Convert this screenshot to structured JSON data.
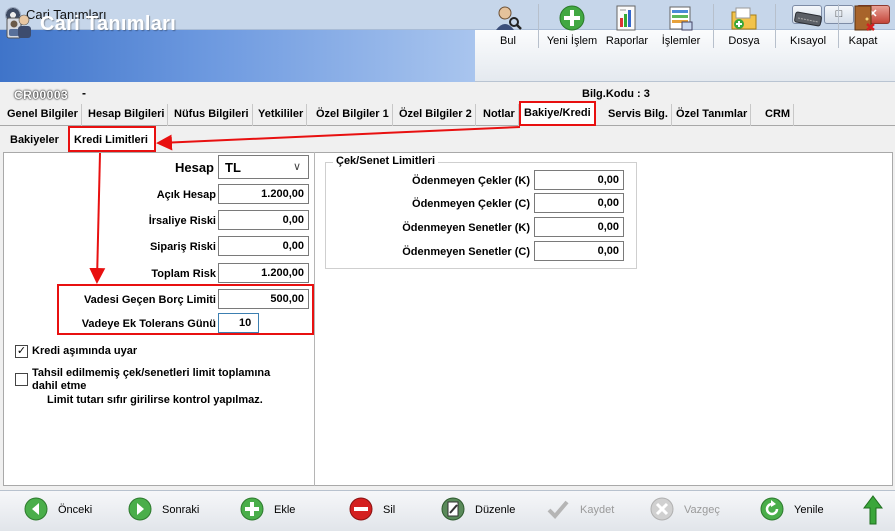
{
  "window": {
    "title": "Cari Tanımları"
  },
  "banner": {
    "title": "Cari Tanımları"
  },
  "toolbar": [
    {
      "label": "Bul",
      "icon": "user-search-icon"
    },
    {
      "label": "Yeni İşlem",
      "icon": "plus-circle-icon"
    },
    {
      "label": "Raporlar",
      "icon": "report-icon"
    },
    {
      "label": "İşlemler",
      "icon": "list-chart-icon"
    },
    {
      "label": "Dosya",
      "icon": "folder-icon"
    },
    {
      "label": "Kısayol",
      "icon": "keyboard-icon"
    },
    {
      "label": "Kapat",
      "icon": "door-exit-icon"
    }
  ],
  "record": {
    "code": "CR00003",
    "dash": "-",
    "bilg_kodu": "Bilg.Kodu : 3"
  },
  "tabs": [
    "Genel Bilgiler",
    "Hesap Bilgileri",
    "Nüfus Bilgileri",
    "Yetkililer",
    "Özel Bilgiler 1",
    "Özel Bilgiler 2",
    "Notlar",
    "Bakiye/Kredi",
    "Servis Bilg.",
    "Özel Tanımlar",
    "CRM"
  ],
  "active_tab": "Bakiye/Kredi",
  "subtabs": [
    "Bakiyeler",
    "Kredi Limitleri"
  ],
  "active_subtab": "Kredi Limitleri",
  "form": {
    "hesap_label": "Hesap",
    "hesap_value": "TL",
    "fields": [
      {
        "label": "Açık Hesap",
        "value": "1.200,00"
      },
      {
        "label": "İrsaliye Riski",
        "value": "0,00"
      },
      {
        "label": "Sipariş Riski",
        "value": "0,00"
      },
      {
        "label": "Toplam Risk",
        "value": "1.200,00"
      },
      {
        "label": "Vadesi Geçen Borç Limiti",
        "value": "500,00"
      },
      {
        "label": "Vadeye Ek Tolerans Günü",
        "value": "10"
      }
    ],
    "check_kredi": {
      "label": "Kredi aşımında uyar",
      "checked": true
    },
    "check_tahsil": {
      "label1": "Tahsil edilmemiş çek/senetleri limit toplamına",
      "label2": "dahil etme",
      "checked": false
    },
    "note": "Limit tutarı sıfır girilirse kontrol yapılmaz."
  },
  "cek_senet": {
    "title": "Çek/Senet Limitleri",
    "fields": [
      {
        "label": "Ödenmeyen Çekler (K)",
        "value": "0,00"
      },
      {
        "label": "Ödenmeyen Çekler (C)",
        "value": "0,00"
      },
      {
        "label": "Ödenmeyen Senetler (K)",
        "value": "0,00"
      },
      {
        "label": "Ödenmeyen Senetler (C)",
        "value": "0,00"
      }
    ]
  },
  "nav": [
    {
      "label": "Önceki",
      "icon": "arrow-left-icon",
      "enabled": true
    },
    {
      "label": "Sonraki",
      "icon": "arrow-right-icon",
      "enabled": true
    },
    {
      "label": "Ekle",
      "icon": "plus-icon",
      "enabled": true
    },
    {
      "label": "Sil",
      "icon": "minus-icon",
      "enabled": true
    },
    {
      "label": "Düzenle",
      "icon": "edit-icon",
      "enabled": true
    },
    {
      "label": "Kaydet",
      "icon": "check-icon",
      "enabled": false
    },
    {
      "label": "Vazgeç",
      "icon": "cancel-icon",
      "enabled": false
    },
    {
      "label": "Yenile",
      "icon": "refresh-icon",
      "enabled": true
    },
    {
      "label": "",
      "icon": "up-arrow-icon",
      "enabled": true
    }
  ],
  "colors": {
    "highlight": "#e81010",
    "banner": "#3f74c9",
    "green": "#3aa63a",
    "red": "#d42020"
  }
}
